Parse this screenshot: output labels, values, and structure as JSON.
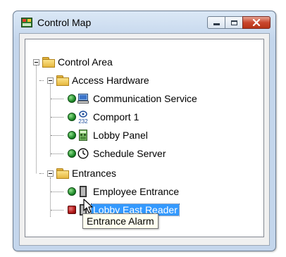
{
  "window": {
    "title": "Control Map"
  },
  "tree": {
    "root": {
      "label": "Control Area",
      "icon": "folder-icon",
      "expanded": true
    },
    "groups": [
      {
        "label": "Access Hardware",
        "icon": "folder-icon",
        "expanded": true,
        "items": [
          {
            "label": "Communication Service",
            "status": "online",
            "icon": "computer-icon"
          },
          {
            "label": "Comport 1",
            "status": "online",
            "icon": "comport-icon"
          },
          {
            "label": "Lobby Panel",
            "status": "online",
            "icon": "panel-icon"
          },
          {
            "label": "Schedule Server",
            "status": "online",
            "icon": "clock-icon"
          }
        ]
      },
      {
        "label": "Entrances",
        "icon": "folder-icon",
        "expanded": true,
        "items": [
          {
            "label": "Employee Entrance",
            "status": "online",
            "icon": "door-icon"
          },
          {
            "label": "Lobby East Reader",
            "status": "alarm",
            "icon": "door-icon",
            "selected": true
          }
        ]
      }
    ]
  },
  "tooltip": {
    "text": "Entrance Alarm"
  },
  "colors": {
    "selection": "#3399ff",
    "status_online": "#1f8a2a",
    "status_alarm": "#b01818"
  }
}
